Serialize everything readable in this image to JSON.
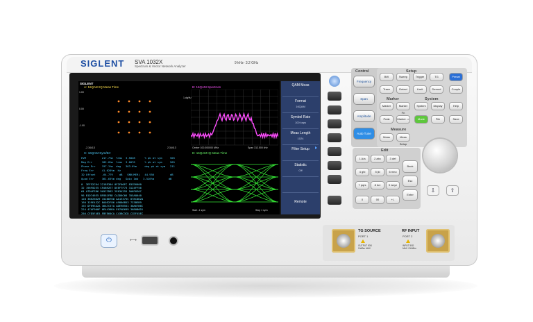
{
  "brand": {
    "logo": "SIGLENT",
    "model": "SVA 1032X",
    "subtitle": "Spectrum & Vector Network Analyzer",
    "freq_range": "9 kHz- 3.2 GHz"
  },
  "screen": {
    "logo": "SIGLENT",
    "const": {
      "title": "A: 16QAM IQ Meas Time",
      "ytop": "1.00",
      "ymid": "0.00",
      "ybot": "-1.00",
      "xleft": "-2.34413",
      "xright": "2.34413"
    },
    "spectrum": {
      "title": "B: 16QAM Spectrum",
      "ylabel": "1.dg/Hz",
      "footer_left": "Center 100.000000 MHz",
      "footer_right": "Span 312.500 kHz"
    },
    "table": {
      "title": "C: 16QAM Sym/Err",
      "rows": [
        "EVM          217.7%m  %rms  3.5028      % pk at sym     505",
        "Mag Err      182.0%m  %rms  3.0076      % pk at sym     505",
        "Phase Err    197.1%m  deg   363.6%m     deg pk at sym   211",
        "Freq Err     41.620%m  Hz",
        "IQ Offset    -64.779    dB   SNR(MER)   44.956          dB",
        "Quad Err     361.63%m deg   Gain Imb   3.526%m         dB"
      ],
      "hex": [
        "0  3EF52C64 2218E304 0F2F00FC 83CE6600",
        "32 196F02E5 CFAB92E7 DEEF7F73 3124FF56",
        "64 A7D4FE86 9A5CCD62 2E634255 5A6F6E6C",
        "96 B1D746E5 BF881FBD CA3D6C66 355A8640",
        "128 38E25D29 1528876D AA1E375C 078CDD2A",
        "160 329E432C 8A0E2F86 A9886B53 733BEB9",
        "192 DFE9EA2A 36A7C57A ADE98551 30A67B6C",
        "224 47AF900F 0E4430DA E07AD699 3680B6D1",
        "256 CFD5F4E5 FBFE60CA C43BC3CD CCEF45EC"
      ]
    },
    "eye": {
      "title": "D: 16QAM IQ Meas Time",
      "footer_left": "Start -1 sym",
      "footer_right": "Stop 1 sym"
    }
  },
  "softkeys": [
    {
      "title": "QAM Meas",
      "value": ""
    },
    {
      "title": "Format",
      "value": "16QAM"
    },
    {
      "title": "Symbol Rate",
      "value": "100 ksps"
    },
    {
      "title": "Meas Length",
      "value": "1024"
    },
    {
      "title": "Filter Setup",
      "value": ""
    },
    {
      "title": "Statistic",
      "value": "Off"
    },
    {
      "title": "",
      "value": ""
    },
    {
      "title": "Remote",
      "value": ""
    }
  ],
  "panels": {
    "control": {
      "title": "Control",
      "keys": [
        "Frequency",
        "Span",
        "Amplitude",
        "Auto Tune"
      ]
    },
    "setup": {
      "title": "Setup",
      "keys": [
        "BW",
        "Sweep",
        "Trigger",
        "TG",
        "Preset",
        "Trace",
        "Detect",
        "Limit",
        "Demod",
        "Couple"
      ]
    },
    "marker": {
      "title": "Marker",
      "keys": [
        "Marker",
        "Marker Fn",
        "Peak",
        "Marker ->"
      ]
    },
    "system": {
      "title": "System",
      "keys": [
        "System",
        "Display",
        "Help",
        "Mode",
        "File",
        "Save"
      ]
    },
    "measure": {
      "title": "Measure",
      "keys": [
        "Meas",
        "Meas Setup"
      ]
    },
    "edit": {
      "title": "Edit",
      "keys": [
        "1 A/a",
        "2 abc",
        "3 def",
        "4 ghi",
        "5 jkl",
        "6 mno",
        "7 pqrs",
        "8 tuv",
        "9 wxyz",
        "0",
        "00",
        "+/-",
        "Back",
        "Esc",
        "Enter"
      ]
    }
  },
  "ports": {
    "tg": {
      "title": "TG SOURCE",
      "port": "PORT 1",
      "note": "OUTPUT 50Ω\n10dBm MAX"
    },
    "rf": {
      "title": "RF INPUT",
      "port": "PORT 2",
      "note": "INPUT 50Ω\nMAX +30dBm"
    }
  },
  "colors": {
    "brand": "#1d4ea3",
    "softkey_bg": "#2c3f6b",
    "spectrum": "#ff57ff",
    "eye": "#3cff3c",
    "measure_text": "#4fd0ff",
    "mode_key": "#5ec73d",
    "preset_key": "#2b6fd6",
    "control_key": "#2f8ee6"
  }
}
